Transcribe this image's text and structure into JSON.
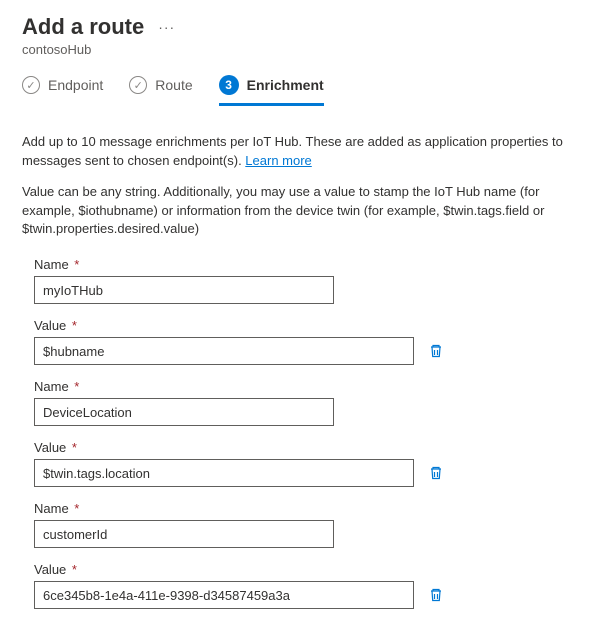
{
  "header": {
    "title": "Add a route",
    "subtitle": "contosoHub"
  },
  "steps": [
    {
      "label": "Endpoint",
      "state": "done"
    },
    {
      "label": "Route",
      "state": "done"
    },
    {
      "label": "Enrichment",
      "state": "active",
      "number": "3"
    }
  ],
  "description": {
    "intro_a": "Add up to 10 message enrichments per IoT Hub. These are added as application properties to messages sent to chosen endpoint(s). ",
    "learn_more": "Learn more",
    "value_hint": "Value can be any string. Additionally, you may use a value to stamp the IoT Hub name (for example, $iothubname) or information from the device twin (for example, $twin.tags.field or $twin.properties.desired.value)"
  },
  "labels": {
    "name": "Name",
    "value": "Value"
  },
  "enrichments": [
    {
      "name": "myIoTHub",
      "value": "$hubname"
    },
    {
      "name": "DeviceLocation",
      "value": "$twin.tags.location"
    },
    {
      "name": "customerId",
      "value": "6ce345b8-1e4a-411e-9398-d34587459a3a"
    }
  ]
}
